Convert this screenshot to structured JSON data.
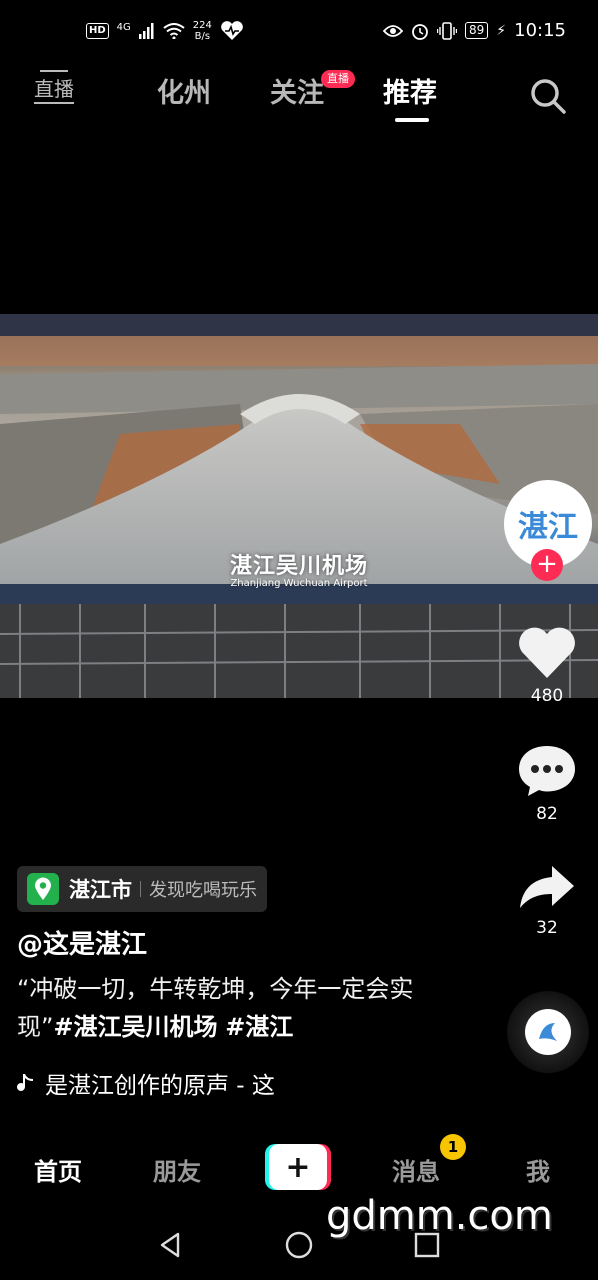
{
  "status_bar": {
    "hd": "HD",
    "signal": "4G",
    "net_speed_value": "224",
    "net_speed_unit": "B/s",
    "battery": "89",
    "time": "10:15"
  },
  "top_nav": {
    "live_label": "直播",
    "tabs": [
      {
        "label": "化州",
        "active": false
      },
      {
        "label": "关注",
        "active": false
      },
      {
        "label": "推荐",
        "active": true
      }
    ],
    "live_badge": "直播"
  },
  "video": {
    "caption_cn": "湛江吴川机场",
    "caption_en": "Zhanjiang Wuchuan Airport"
  },
  "right_rail": {
    "avatar_text": "湛江",
    "likes": "480",
    "comments": "82",
    "shares": "32"
  },
  "post": {
    "poi_name": "湛江市",
    "poi_desc": "发现吃喝玩乐",
    "author": "@这是湛江",
    "desc_text": "“冲破一切，牛转乾坤，今年一定会实现”",
    "hashtag_1": "#湛江吴川机场",
    "hashtag_2": "#湛江",
    "music": "是湛江创作的原声 - 这"
  },
  "bottom_tabs": {
    "home": "首页",
    "friends": "朋友",
    "add": "+",
    "messages": "消息",
    "messages_badge": "1",
    "me": "我"
  },
  "watermark": "gdmm.com",
  "colors": {
    "accent_red": "#fe2c55",
    "accent_cyan": "#25f4ee",
    "poi_green": "#22b14c",
    "badge_yellow": "#f7c600"
  }
}
